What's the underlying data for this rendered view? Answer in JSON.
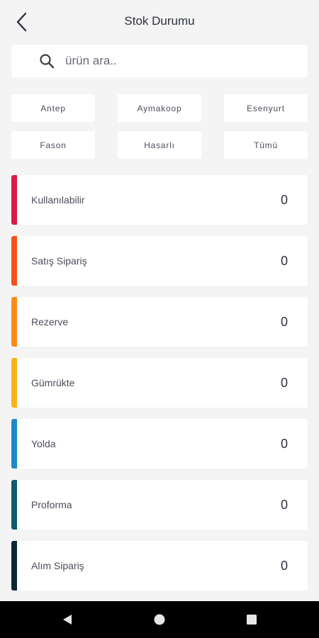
{
  "header": {
    "title": "Stok Durumu",
    "back_icon": "chevron-left-icon"
  },
  "search": {
    "placeholder": "ürün ara..",
    "value": "",
    "icon": "search-icon"
  },
  "filters": [
    {
      "label": "Antep"
    },
    {
      "label": "Aymakoop"
    },
    {
      "label": "Esenyurt"
    },
    {
      "label": "Fason"
    },
    {
      "label": "Hasarlı"
    },
    {
      "label": "Tümü"
    }
  ],
  "stock_rows": [
    {
      "label": "Kullanılabilir",
      "value": "0",
      "color": "#d81b4a"
    },
    {
      "label": "Satış Sipariş",
      "value": "0",
      "color": "#f4511e"
    },
    {
      "label": "Rezerve",
      "value": "0",
      "color": "#fb8c1a"
    },
    {
      "label": "Gümrükte",
      "value": "0",
      "color": "#fbb01a"
    },
    {
      "label": "Yolda",
      "value": "0",
      "color": "#1e88c9"
    },
    {
      "label": "Proforma",
      "value": "0",
      "color": "#0f5a6e"
    },
    {
      "label": "Alım Sipariş",
      "value": "0",
      "color": "#0a2a35"
    }
  ],
  "navbar": {
    "back": "back-triangle-icon",
    "home": "home-circle-icon",
    "recents": "recents-square-icon"
  }
}
